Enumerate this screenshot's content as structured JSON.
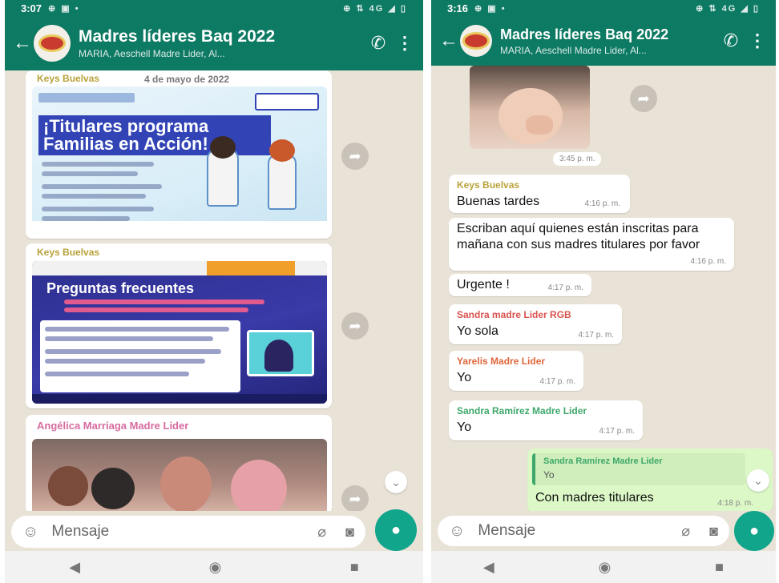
{
  "left": {
    "status": {
      "time": "3:07",
      "indicators": "⊕ ▣ •",
      "right_icons": "⊕ ⇅ 4G ◢ ▯"
    },
    "header": {
      "back": "←",
      "title": "Madres líderes Baq 2022",
      "subtitle": "MARIA, Aeschell Madre Lider, Al..."
    },
    "messages": [
      {
        "sender": "Keys Buelvas",
        "date": "4 de mayo de 2022",
        "poster_title": "¡Titulares programa Familias en Acción!"
      },
      {
        "sender": "Keys Buelvas",
        "poster_title": "Preguntas frecuentes"
      },
      {
        "sender": "Angélica Marriaga Madre Lider"
      }
    ],
    "input": {
      "placeholder": "Mensaje"
    }
  },
  "right": {
    "status": {
      "time": "3:16",
      "indicators": "⊕ ▣ •",
      "right_icons": "⊕ ⇅ 4G ◢ ▯"
    },
    "header": {
      "back": "←",
      "title": "Madres líderes Baq 2022",
      "subtitle": "MARIA, Aeschell Madre Lider, Al..."
    },
    "sticker_time": "3:45 p. m.",
    "messages": [
      {
        "sender": "Keys Buelvas",
        "text": "Buenas tardes",
        "time": "4:16 p. m."
      },
      {
        "text": "Escriban aquí quienes están inscritas para mañana con sus madres titulares por favor",
        "time": "4:16 p. m."
      },
      {
        "text": "Urgente !",
        "time": "4:17 p. m."
      },
      {
        "sender": "Sandra madre Lider RGB",
        "text": "Yo sola",
        "time": "4:17 p. m."
      },
      {
        "sender": "Yarelis Madre Lider",
        "text": "Yo",
        "time": "4:17 p. m."
      },
      {
        "sender": "Sandra Ramírez Madre Lider",
        "text": "Yo",
        "time": "4:17 p. m."
      }
    ],
    "reply": {
      "quoted_sender": "Sandra Ramírez Madre Lider",
      "quoted_text": "Yo",
      "text": "Con madres titulares",
      "time": "4:18 p. m."
    },
    "input": {
      "placeholder": "Mensaje"
    }
  },
  "icons": {
    "call": "call-add-icon",
    "menu": "more-vertical-icon",
    "emoji": "emoji-icon",
    "clip": "attach-icon",
    "camera": "camera-icon",
    "mic": "mic-icon",
    "forward": "forward-icon"
  },
  "colors": {
    "header": "#0d7a63",
    "mic": "#11a58b",
    "wallpaper": "#e9e2d7",
    "sender_keys": "#b9a23a",
    "sender_sandra": "#d9534f",
    "sender_yarelis": "#e0653a",
    "sender_ramirez": "#3ea86a",
    "sender_angelica": "#d76ba0",
    "reply_bg": "#dcf8c6"
  }
}
